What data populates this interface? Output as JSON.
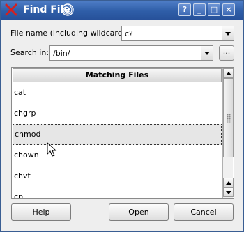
{
  "window": {
    "title": "Find File"
  },
  "titlebar_buttons": {
    "help": "?",
    "minimize": "_",
    "maximize": "□",
    "close": "×"
  },
  "filename": {
    "label": "File name (including wildcards):",
    "value": "c?"
  },
  "search_in": {
    "label": "Search in:",
    "value": "/bin/",
    "browse_label": "..."
  },
  "results": {
    "header": "Matching Files",
    "items": [
      "cat",
      "chgrp",
      "chmod",
      "chown",
      "chvt",
      "cp"
    ],
    "selected_index": 2
  },
  "buttons": {
    "help": "Help",
    "open": "Open",
    "cancel": "Cancel"
  },
  "colors": {
    "titlebar": "#2f5ea8",
    "close_x": "#cc2222"
  },
  "icons": {
    "app": "red-x-icon",
    "swirl": "swirl-icon",
    "cursor": "mouse-pointer-icon"
  }
}
